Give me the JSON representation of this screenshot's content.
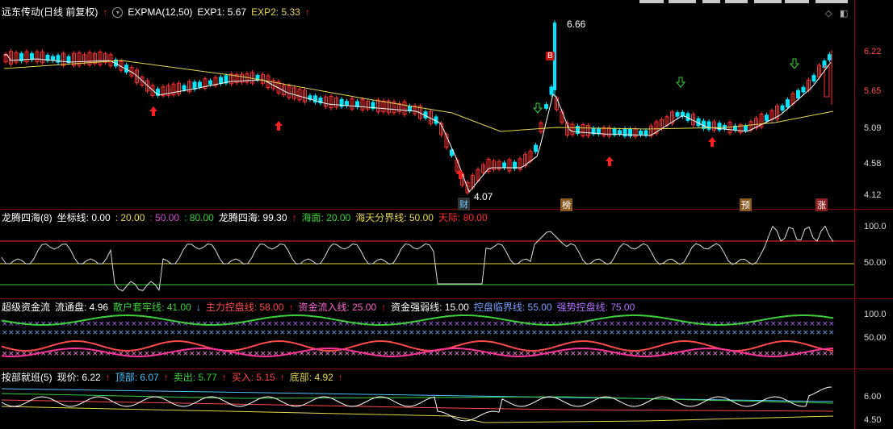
{
  "main_header": {
    "stock": "远东传动(日线 前复权)",
    "indicator": "EXPMA(12,50)",
    "exp1_label": "EXP1: 5.67",
    "exp2_label": "EXP2: 5.33"
  },
  "price_axis": [
    "6.22",
    "5.65",
    "5.09",
    "4.58",
    "4.12"
  ],
  "annotations": {
    "high": "6.66",
    "low": "4.07",
    "b_tag": "B"
  },
  "markers": {
    "cai": "财",
    "bang": "榜",
    "yu": "预",
    "zhang": "涨"
  },
  "panel2": {
    "title": "龙腾四海(8)",
    "zuobiao": "坐标线: 0.00",
    "v1": ": 20.00",
    "v2": ": 50.00",
    "v3": ": 80.00",
    "lthh": "龙腾四海: 99.30",
    "haimian": "海面: 20.00",
    "haitian": "海天分界线: 50.00",
    "tianji": "天际: 80.00",
    "axis": [
      "100.0",
      "50.00"
    ]
  },
  "panel3": {
    "title": "超级资金流",
    "liutong": "流通盘: 4.96",
    "sanhu": "散户套牢线: 41.00",
    "zhuli": "主力控盘线: 58.00",
    "zijin": "资金流入线: 25.00",
    "ruoqiang": "资金强弱线: 15.00",
    "kongpan": "控盘临界线: 55.00",
    "qiangshi": "强势控盘线: 75.00",
    "axis": [
      "100.0",
      "50.00"
    ]
  },
  "panel4": {
    "title": "按部就班(5)",
    "xianjia": "现价: 6.22",
    "dingbu": "顶部: 6.07",
    "maichu": "卖出: 5.77",
    "mairu": "买入: 5.15",
    "dibu": "底部: 4.92",
    "axis": [
      "6.00",
      "4.50"
    ]
  },
  "colors": {
    "up": "#ff3030",
    "down": "#00e5ff",
    "exp1": "#ffffff",
    "exp2": "#e6d84a",
    "grid": "#7a0000"
  }
}
